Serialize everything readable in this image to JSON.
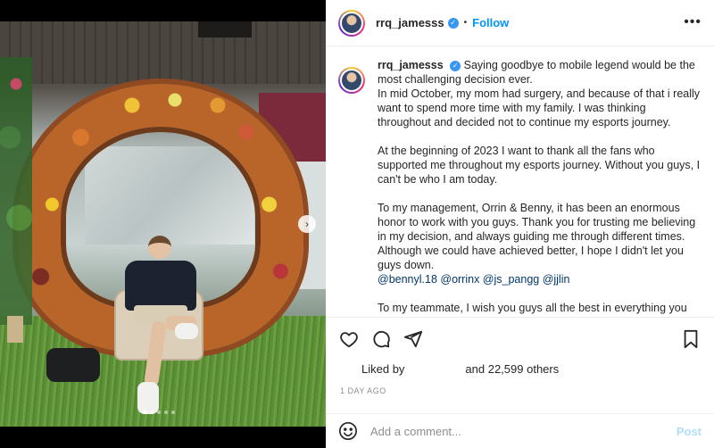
{
  "post": {
    "username": "rrq_jamesss",
    "follow_label": "Follow",
    "separator": "•",
    "more_label": "•••",
    "next_label": "›",
    "photo_page_count": 5,
    "photo_current_index": 0
  },
  "caption": {
    "username": "rrq_jamesss",
    "line1": "Saying goodbye to mobile legend would be the most challenging decision ever.",
    "line2": "In mid October, my mom had surgery, and because of that i really want to spend more time with my family. I was thinking throughout and decided not to continue my esports journey.",
    "line3": "At the beginning of 2023 I want to thank all the fans who supported me throughout my esports journey. Without you guys, I can't be who I am today.",
    "line4": "To my management, Orrin & Benny, it has been an enormous honor to work with you guys. Thank you for trusting me believing in my decision, and always guiding me through different times. Although we could have achieved better, I hope I didn't let you guys down.",
    "mentions": "@bennyl.18 @orrinx @js_pangg @jjlin",
    "line5": "To my teammate, I wish you guys all the best in everything you"
  },
  "likes": {
    "liked_by": "Liked by",
    "others": "and 22,599 others"
  },
  "time": "1 DAY AGO",
  "comment": {
    "placeholder": "Add a comment...",
    "post_label": "Post"
  },
  "colors": {
    "accent": "#0095f6",
    "verified": "#3897f0",
    "muted": "#8e8e8e",
    "post_disabled": "#b2dffc"
  },
  "icons": [
    "heart-icon",
    "comment-icon",
    "share-icon",
    "bookmark-icon",
    "emoji-icon",
    "verified-icon",
    "more-icon",
    "next-arrow-icon"
  ]
}
